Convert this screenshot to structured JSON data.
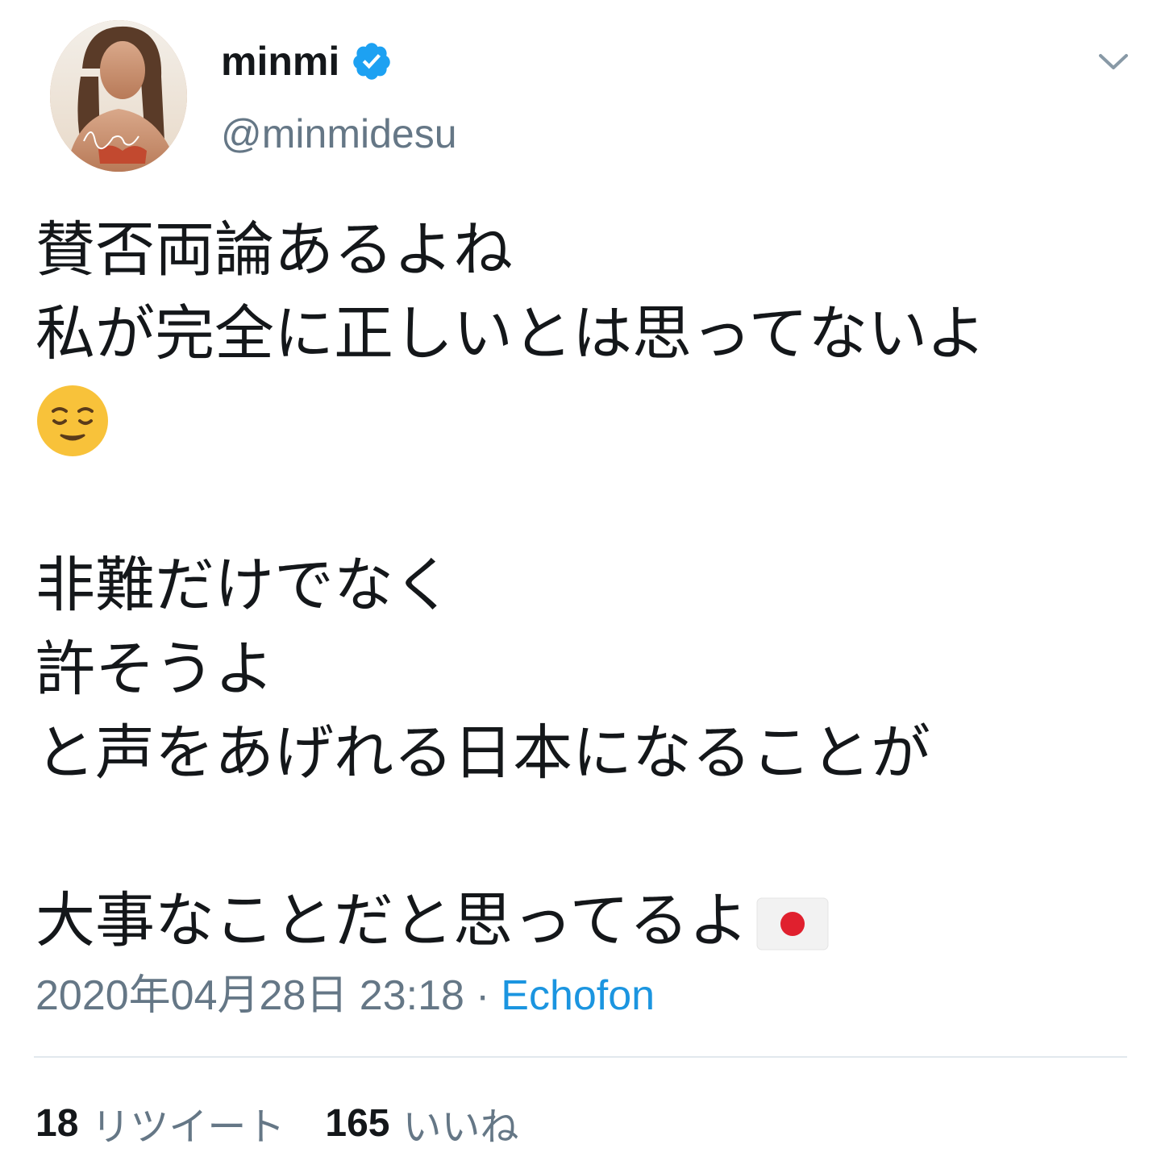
{
  "author": {
    "display_name": "minmi",
    "screen_name": "@minmidesu",
    "verified_icon": "verified-badge-icon",
    "avatar_icon": "profile-photo"
  },
  "menu": {
    "chevron_icon": "chevron-down-icon"
  },
  "tweet": {
    "lines": [
      "賛否両論あるよね",
      "私が完全に正しいとは思ってないよ",
      "😌",
      "",
      "非難だけでなく",
      "許そうよ",
      "と声をあげれる日本になることが",
      "",
      "大事なことだと思ってるよ🇯🇵"
    ]
  },
  "meta": {
    "timestamp": "2020年04月28日 23:18",
    "separator": "·",
    "client": "Echofon"
  },
  "stats": {
    "retweet_count": "18",
    "retweet_label": "リツイート",
    "like_count": "165",
    "like_label": "いいね"
  },
  "colors": {
    "text": "#14171a",
    "secondary": "#657786",
    "link": "#1b95e0",
    "verified": "#1da1f2",
    "divider": "#e1e8ed"
  }
}
